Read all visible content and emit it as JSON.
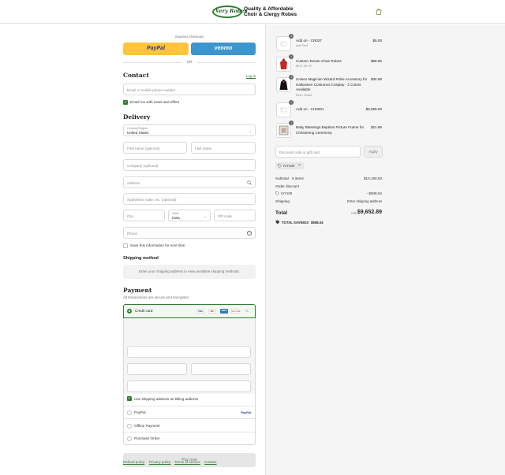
{
  "header": {
    "logo_script": "Very Robes",
    "logo_line1": "Quality & Affordable",
    "logo_line2": "Choir & Clergy Robes",
    "cart_icon": "shopping-bag-icon"
  },
  "express": {
    "title": "Express checkout",
    "paypal_label": "PayPal",
    "venmo_label": "venmo",
    "or_label": "OR"
  },
  "contact": {
    "heading": "Contact",
    "login_link": "Log in",
    "email_placeholder": "Email or mobile phone number",
    "newsletter_label": "Email me with news and offers",
    "newsletter_checked": true
  },
  "delivery": {
    "heading": "Delivery",
    "country_label": "Country/Region",
    "country_value": "United States",
    "first_name_placeholder": "First name (optional)",
    "last_name_placeholder": "Last name",
    "company_placeholder": "Company (optional)",
    "address_placeholder": "Address",
    "apartment_placeholder": "Apartment, suite, etc. (optional)",
    "city_placeholder": "City",
    "state_label": "State",
    "state_value": "Iowa",
    "zip_placeholder": "ZIP code",
    "phone_placeholder": "Phone",
    "save_info_label": "Save this information for next time",
    "save_info_checked": false
  },
  "shipping": {
    "heading": "Shipping method",
    "message": "Enter your shipping address to view available shipping methods."
  },
  "payment": {
    "heading": "Payment",
    "subtitle": "All transactions are secure and encrypted.",
    "credit_card_label": "Credit card",
    "card_brands": [
      "VISA",
      "MC",
      "AMEX",
      "DISCOVER"
    ],
    "more_cards": "+3",
    "billing_same_label": "Use shipping address as billing address",
    "billing_same_checked": true,
    "paypal_label": "PayPal",
    "paypal_logo": "PayPal",
    "offline_label": "Offline Payment",
    "po_label": "Purchase Order",
    "pay_button": "Pay now",
    "accent_color": "#2e7d32"
  },
  "footer": {
    "links": [
      "Refund policy",
      "Privacy policy",
      "Terms of service",
      "Contact"
    ]
  },
  "order": {
    "items": [
      {
        "qty": "1",
        "name": "Add on - CR027",
        "variant": "Add Text",
        "price": "$5.00"
      },
      {
        "qty": "1",
        "name": "Custom Tenuto Choir Robes",
        "variant": "5ft 8\"-5ft 10\"",
        "price": "$99.95"
      },
      {
        "qty": "1",
        "name": "Unisex Magician Wizard Robe Accessory for Halloween Costumes Cosplay - 2 Colors Available",
        "variant": "Red / Small",
        "price": "$34.99"
      },
      {
        "qty": "1",
        "name": "Add on - CH0001",
        "variant": "",
        "price": "$9,999.00"
      },
      {
        "qty": "1",
        "name": "Baby Blessings Baptism Picture Frame for Christening Ceremony",
        "variant": "",
        "price": "$21.99"
      }
    ],
    "discount_placeholder": "Discount code or gift card",
    "apply_label": "Apply",
    "applied_code": "IVY100",
    "subtotal_label": "Subtotal · 5 items",
    "subtotal_value": "$10,160.93",
    "order_discount_label": "Order discount",
    "discount_code": "IVY100",
    "discount_value": "- $508.04",
    "shipping_label": "Shipping",
    "shipping_value": "Enter shipping address",
    "total_label": "Total",
    "currency": "USD",
    "total_value": "$9,652.89",
    "savings_label": "TOTAL SAVINGS",
    "savings_value": "$508.04"
  }
}
